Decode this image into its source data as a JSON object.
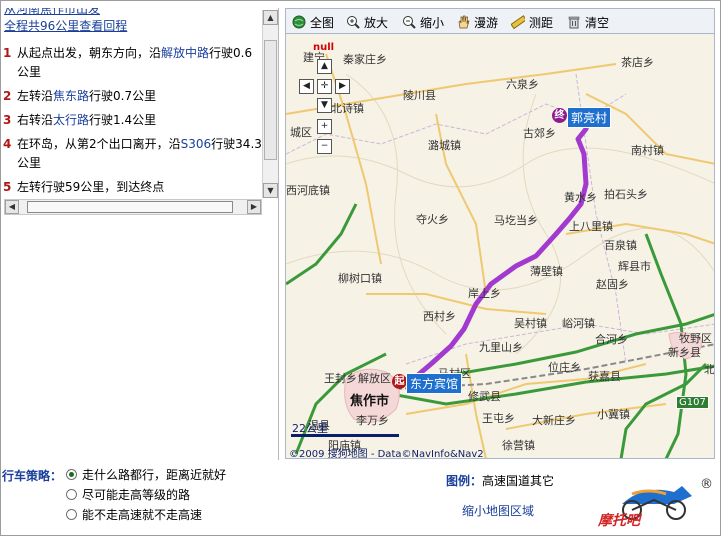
{
  "route": {
    "summary_cut": "从河南焦作市出发",
    "summary": "全程共96公里查看回程",
    "steps": [
      {
        "num": "1",
        "pre": "从起点出发，朝东方向，沿",
        "road": "解放中路",
        "post": "行驶0.6公里"
      },
      {
        "num": "2",
        "pre": "左转沿",
        "road": "焦东路",
        "post": "行驶0.7公里"
      },
      {
        "num": "3",
        "pre": "右转沿",
        "road": "太行路",
        "post": "行驶1.4公里"
      },
      {
        "num": "4",
        "pre": "在环岛，从第2个出口离开，沿",
        "road": "S306",
        "post": "行驶34.3公里"
      },
      {
        "num": "5",
        "pre": "左转行驶59公里，到达终点",
        "road": "",
        "post": ""
      }
    ]
  },
  "toolbar": {
    "full": "全图",
    "zoom_in": "放大",
    "zoom_out": "缩小",
    "pan": "漫游",
    "measure": "测距",
    "clear": "清空"
  },
  "map": {
    "null_text": "null",
    "start_marker": "起",
    "end_marker": "终",
    "start_label": "东方宾馆",
    "end_label": "郭亮村",
    "scale": "22公里",
    "copyright_a": "©2009 搜狗地图",
    "copyright_b": "Data©NavInfo&Nav2",
    "road_g107": "G107",
    "places": [
      "建宁",
      "秦家庄乡",
      "茶店乡",
      "北诗镇",
      "陵川县",
      "六泉乡",
      "潞城镇",
      "古郊乡",
      "南村镇",
      "西河底镇",
      "黄水乡",
      "拍石头乡",
      "夺火乡",
      "马圪当乡",
      "上八里镇",
      "百泉镇",
      "辉县市",
      "柳树口镇",
      "薄壁镇",
      "赵固乡",
      "岸上乡",
      "吴村镇",
      "峪河镇",
      "西村乡",
      "九里山乡",
      "合河乡",
      "牧野区",
      "新乡县",
      "解放区",
      "马村区",
      "王封乡",
      "位庄乡",
      "获嘉县",
      "修武县",
      "焦作市",
      "李万乡",
      "王屯乡",
      "大新庄乡",
      "小冀镇",
      "温县",
      "阳庙镇",
      "徐营镇",
      "城区",
      "北"
    ]
  },
  "strategy": {
    "title": "行车策略：",
    "options": [
      "走什么路都行，距离近就好",
      "尽可能走高等级的路",
      "能不走高速就不走高速"
    ],
    "selected": 0
  },
  "legend": {
    "title": "图例：",
    "items": "高速国道其它",
    "mini_map": "缩小地图区域"
  },
  "logo": {
    "text": "摩托吧"
  },
  "colors": {
    "route": "#a23ad0",
    "highway": "#3a9a3a",
    "link": "#1a3f9b",
    "tag": "#1f6fcf"
  }
}
